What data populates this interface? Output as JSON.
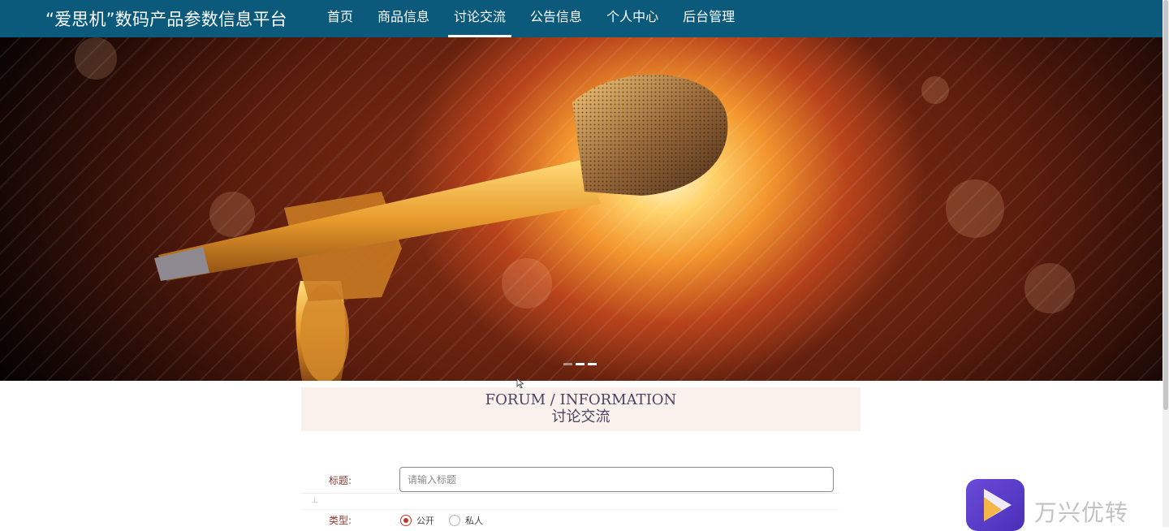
{
  "header": {
    "site_title": "“爱思机”数码产品参数信息平台",
    "nav": [
      {
        "label": "首页",
        "active": false
      },
      {
        "label": "商品信息",
        "active": false
      },
      {
        "label": "讨论交流",
        "active": true
      },
      {
        "label": "公告信息",
        "active": false
      },
      {
        "label": "个人中心",
        "active": false
      },
      {
        "label": "后台管理",
        "active": false
      }
    ],
    "bg_color": "#0b5a7c"
  },
  "banner": {
    "image": "microphone-on-stage",
    "slide_count": 3,
    "active_slide": 2
  },
  "section": {
    "title_en": "FORUM / INFORMATION",
    "title_cn": "讨论交流"
  },
  "form": {
    "title_label": "标题:",
    "title_placeholder": "请输入标题",
    "title_value": "",
    "type_label": "类型:",
    "type_options": [
      {
        "label": "公开",
        "checked": true
      },
      {
        "label": "私人",
        "checked": false
      }
    ]
  },
  "watermark": {
    "text": "万兴优转"
  },
  "colors": {
    "accent": "#c0392b",
    "label": "#8b3a2e"
  }
}
